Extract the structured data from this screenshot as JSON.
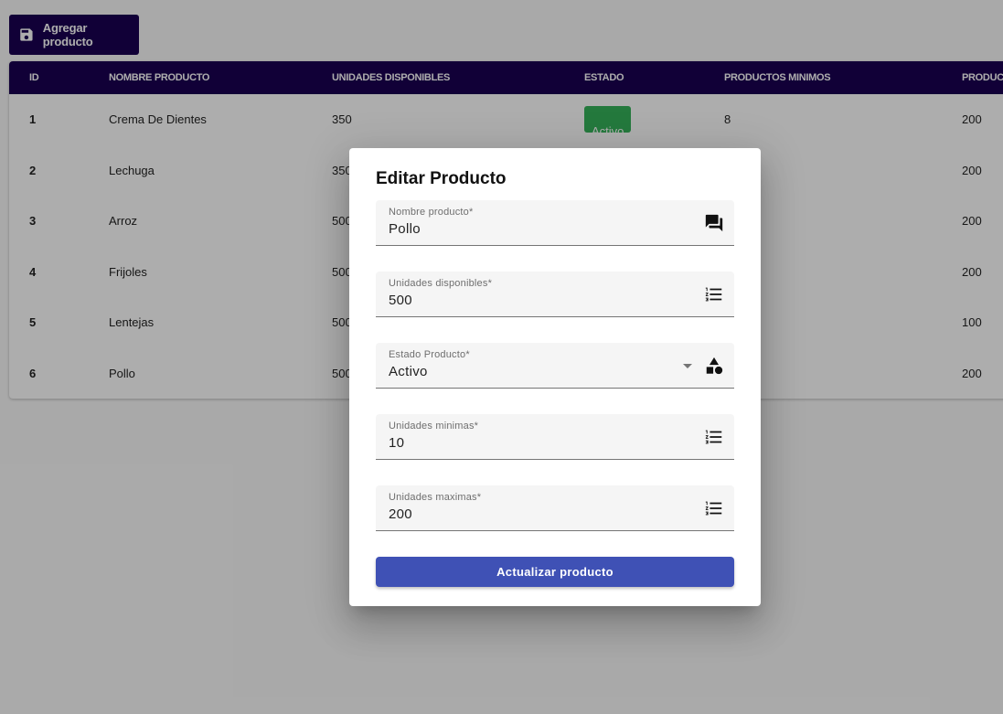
{
  "toolbar": {
    "add_label": "Agregar producto",
    "add_icon": "save-icon"
  },
  "table": {
    "columns": [
      "ID",
      "NOMBRE PRODUCTO",
      "UNIDADES DISPONIBLES",
      "ESTADO",
      "PRODUCTOS MINIMOS",
      "PRODUCT"
    ],
    "rows": [
      {
        "id": "1",
        "name": "Crema De Dientes",
        "units": "350",
        "status": "Activo",
        "min": "8",
        "max": "200"
      },
      {
        "id": "2",
        "name": "Lechuga",
        "units": "350",
        "status": "",
        "min": "",
        "max": "200"
      },
      {
        "id": "3",
        "name": "Arroz",
        "units": "500",
        "status": "",
        "min": "",
        "max": "200"
      },
      {
        "id": "4",
        "name": "Frijoles",
        "units": "500",
        "status": "",
        "min": "",
        "max": "200"
      },
      {
        "id": "5",
        "name": "Lentejas",
        "units": "500",
        "status": "",
        "min": "",
        "max": "100"
      },
      {
        "id": "6",
        "name": "Pollo",
        "units": "500",
        "status": "",
        "min": "",
        "max": "200"
      }
    ],
    "status_color": "#35b35a",
    "header_color": "#1a0052"
  },
  "dialog": {
    "title": "Editar Producto",
    "fields": {
      "name": {
        "label": "Nombre producto*",
        "value": "Pollo",
        "icon": "chat-bubbles-icon"
      },
      "units": {
        "label": "Unidades disponibles*",
        "value": "500",
        "icon": "numbered-list-icon"
      },
      "status": {
        "label": "Estado Producto*",
        "value": "Activo",
        "icon": "shapes-icon"
      },
      "min": {
        "label": "Unidades minimas*",
        "value": "10",
        "icon": "numbered-list-icon"
      },
      "max": {
        "label": "Unidades maximas*",
        "value": "200",
        "icon": "numbered-list-icon"
      }
    },
    "submit_label": "Actualizar producto",
    "submit_color": "#3f51b5"
  }
}
